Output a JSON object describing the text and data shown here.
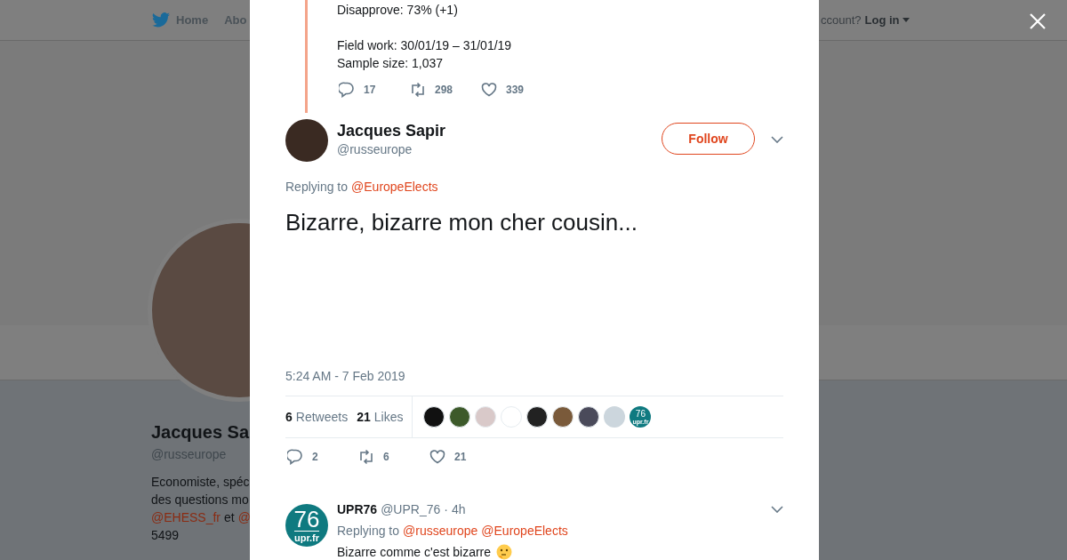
{
  "background": {
    "nav": [
      {
        "kind": "home",
        "label": "Home"
      },
      {
        "kind": "plain",
        "label": "Abo"
      }
    ],
    "login_prompt": "ccount?",
    "login": "Log in",
    "profile": {
      "name": "Jacques Sa",
      "handle": "@russeurope",
      "bio": [
        [
          {
            "kind": "plain",
            "text": "Economiste, spéc"
          }
        ],
        [
          {
            "kind": "plain",
            "text": "des questions mo"
          }
        ],
        [
          {
            "kind": "link",
            "text": "@EHESS_fr"
          },
          {
            "kind": "plain",
            "text": "et"
          },
          {
            "kind": "link",
            "text": "@"
          }
        ],
        [
          {
            "kind": "plain",
            "text": "5499"
          }
        ]
      ]
    }
  },
  "previous_tweet": {
    "paragraphs": [
      [
        "Disapprove: 73% (+1)"
      ],
      [
        "Field work: 30/01/19 – 31/01/19",
        "Sample size: 1,037"
      ]
    ],
    "actions": [
      {
        "kind": "reply",
        "count": "17"
      },
      {
        "kind": "retweet",
        "count": "298"
      },
      {
        "kind": "like",
        "count": "339"
      }
    ]
  },
  "tweet": {
    "name": "Jacques Sapir",
    "handle": "@russeurope",
    "follow": "Follow",
    "replying_label": "Replying to",
    "replying_to": [
      "@EuropeElects"
    ],
    "text": "Bizarre, bizarre mon cher cousin...",
    "time": "5:24 AM - 7 Feb 2019",
    "stats": [
      {
        "count": "6",
        "label": "Retweets"
      },
      {
        "count": "21",
        "label": "Likes"
      }
    ],
    "likers": [
      {
        "kind": "photo",
        "color": "#111111"
      },
      {
        "kind": "photo",
        "color": "#3d5a2a"
      },
      {
        "kind": "photo",
        "color": "#d9c9c9"
      },
      {
        "kind": "photo",
        "color": "#ffffff"
      },
      {
        "kind": "photo",
        "color": "#222222"
      },
      {
        "kind": "photo",
        "color": "#7a5a3a"
      },
      {
        "kind": "photo",
        "color": "#4a4a5a"
      },
      {
        "kind": "default",
        "color": "#ccd6dd"
      },
      {
        "kind": "logo",
        "color": "#0f7a80",
        "number": "76",
        "site": "upr.fr"
      }
    ],
    "actions": [
      {
        "kind": "reply",
        "count": "2"
      },
      {
        "kind": "retweet",
        "count": "6"
      },
      {
        "kind": "like",
        "count": "21"
      }
    ]
  },
  "reply": {
    "name": "UPR76",
    "handle": "@UPR_76",
    "separator": "·",
    "time": "4h",
    "avatar": {
      "number": "76",
      "site": "upr.fr"
    },
    "replying_label": "Replying to",
    "replying_to": [
      "@russeurope",
      "@EuropeElects"
    ],
    "text": "Bizarre comme c'est bizarre"
  }
}
